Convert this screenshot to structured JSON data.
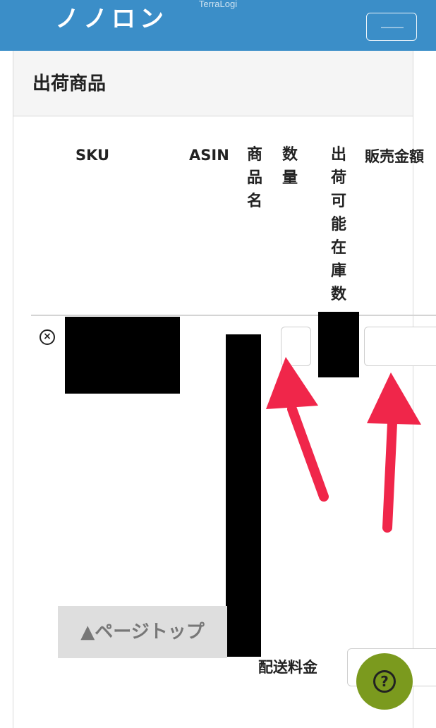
{
  "header": {
    "brand_text": "TerraLogi",
    "cut_logo_text": "ノノロン",
    "menu_icon": "hamburger-icon",
    "bar_color": "#3b8ec8"
  },
  "panel": {
    "title": "出荷商品"
  },
  "table": {
    "columns": {
      "sku": "SKU",
      "asin": "ASIN",
      "product_name": "商品名",
      "quantity": "数量",
      "available_stock": "出荷可能在庫数",
      "sale_price": "販売金額"
    },
    "row": {
      "remove_icon": "remove-circle-icon",
      "quantity_value": "",
      "price_value": ""
    }
  },
  "footer": {
    "page_top_label": "▲ページトップ",
    "shipping_label": "配送料金",
    "shipping_value": "",
    "help_icon": "help-question-icon",
    "help_glyph": "?"
  },
  "annotations": {
    "arrow_color": "#f0264a"
  }
}
